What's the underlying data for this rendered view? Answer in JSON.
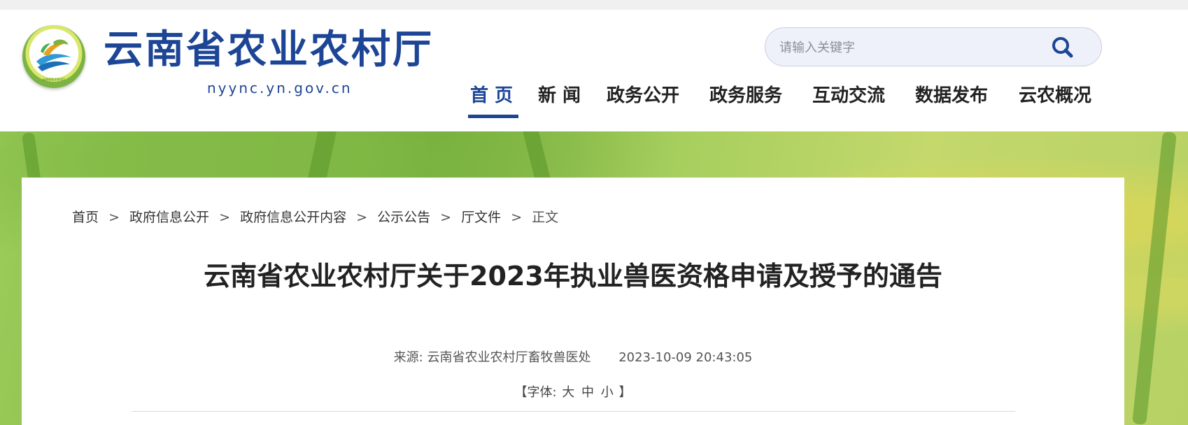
{
  "header": {
    "site_title": "云南省农业农村厅",
    "site_domain": "nyync.yn.gov.cn",
    "logo_ring_text": "云南省农业农村厅"
  },
  "search": {
    "placeholder": "请输入关键字",
    "icon": "search-icon"
  },
  "nav": {
    "items": [
      {
        "label": "首 页",
        "active": true
      },
      {
        "label": "新 闻"
      },
      {
        "label": "政务公开"
      },
      {
        "label": "政务服务"
      },
      {
        "label": "互动交流"
      },
      {
        "label": "数据发布"
      },
      {
        "label": "云农概况"
      }
    ]
  },
  "breadcrumb": {
    "items": [
      "首页",
      "政府信息公开",
      "政府信息公开内容",
      "公示公告",
      "厅文件",
      "正文"
    ],
    "separator": ">"
  },
  "article": {
    "title": "云南省农业农村厅关于2023年执业兽医资格申请及授予的通告",
    "source_label": "来源:",
    "source_value": "云南省农业农村厅畜牧兽医处",
    "datetime": "2023-10-09 20:43:05",
    "font_size": {
      "open": "【字体:",
      "large": "大",
      "medium": "中",
      "small": "小",
      "close": "】"
    }
  },
  "colors": {
    "brand_blue": "#1d4596",
    "nav_text": "#222222",
    "banner_green": "#86b94a"
  }
}
